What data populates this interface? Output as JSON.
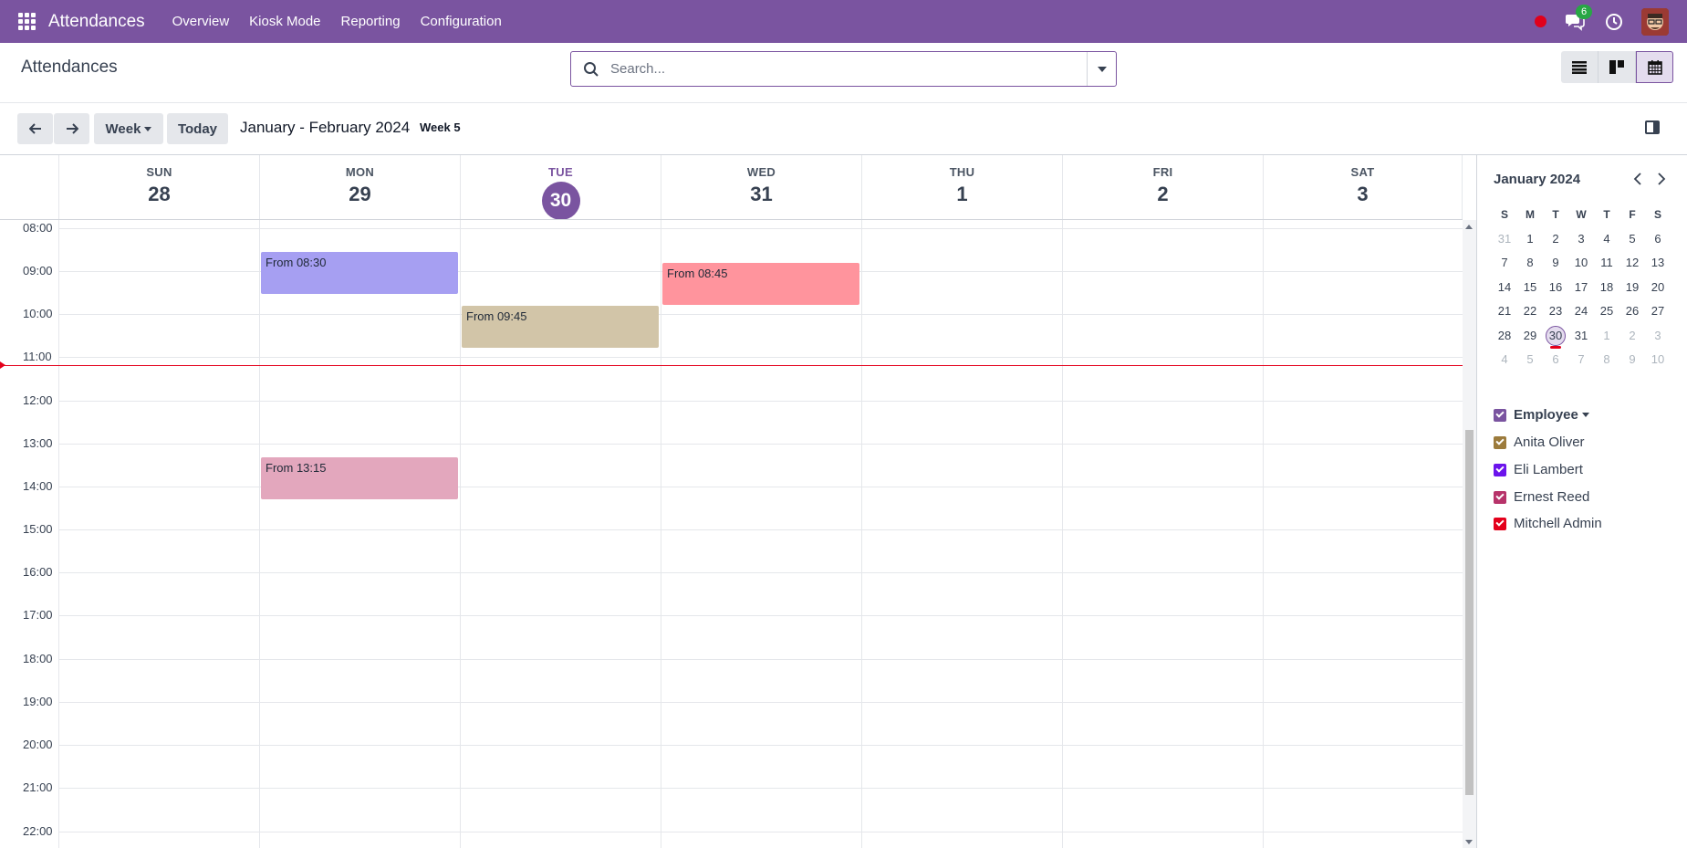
{
  "nav": {
    "app_title": "Attendances",
    "menu": [
      "Overview",
      "Kiosk Mode",
      "Reporting",
      "Configuration"
    ],
    "chat_badge": "6",
    "accent": "#7a54a0"
  },
  "control_panel": {
    "title": "Attendances",
    "search_placeholder": "Search..."
  },
  "toolbar": {
    "scale_label": "Week",
    "today_label": "Today",
    "range_title": "January - February 2024",
    "week_badge": "Week 5"
  },
  "calendar": {
    "days": [
      {
        "name": "SUN",
        "num": "28"
      },
      {
        "name": "MON",
        "num": "29"
      },
      {
        "name": "TUE",
        "num": "30"
      },
      {
        "name": "WED",
        "num": "31"
      },
      {
        "name": "THU",
        "num": "1"
      },
      {
        "name": "FRI",
        "num": "2"
      },
      {
        "name": "SAT",
        "num": "3"
      }
    ],
    "hours": [
      "08:00",
      "09:00",
      "10:00",
      "11:00",
      "12:00",
      "13:00",
      "14:00",
      "15:00",
      "16:00",
      "17:00",
      "18:00",
      "19:00",
      "20:00",
      "21:00",
      "22:00"
    ],
    "events": [
      {
        "label": "From 08:30",
        "day": "MON",
        "color": "#a69ff2"
      },
      {
        "label": "From 08:45",
        "day": "WED",
        "color": "#ff949d"
      },
      {
        "label": "From 09:45",
        "day": "TUE",
        "color": "#d2c5a8"
      },
      {
        "label": "From 13:15",
        "day": "MON",
        "color": "#e3a7bd"
      }
    ]
  },
  "sidebar": {
    "mini_title": "January 2024",
    "weekday_heads": [
      "S",
      "M",
      "T",
      "W",
      "T",
      "F",
      "S"
    ],
    "weeks": [
      [
        "31",
        "1",
        "2",
        "3",
        "4",
        "5",
        "6"
      ],
      [
        "7",
        "8",
        "9",
        "10",
        "11",
        "12",
        "13"
      ],
      [
        "14",
        "15",
        "16",
        "17",
        "18",
        "19",
        "20"
      ],
      [
        "21",
        "22",
        "23",
        "24",
        "25",
        "26",
        "27"
      ],
      [
        "28",
        "29",
        "30",
        "31",
        "1",
        "2",
        "3"
      ],
      [
        "4",
        "5",
        "6",
        "7",
        "8",
        "9",
        "10"
      ]
    ],
    "filter_header": "Employee",
    "filters": [
      {
        "label": "Anita Oliver",
        "color": "#9c7b3c"
      },
      {
        "label": "Eli Lambert",
        "color": "#6b14ec"
      },
      {
        "label": "Ernest Reed",
        "color": "#b7336a"
      },
      {
        "label": "Mitchell Admin",
        "color": "#e4001b"
      }
    ]
  }
}
